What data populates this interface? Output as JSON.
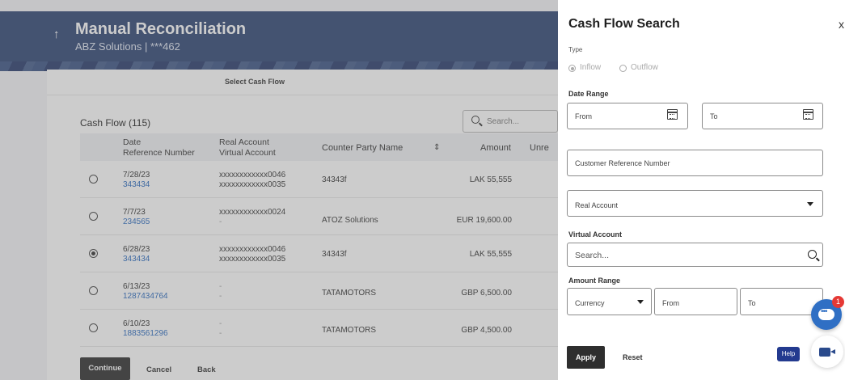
{
  "page": {
    "title": "Manual Reconciliation",
    "subtitle": "ABZ Solutions | ***462",
    "back_icon": "↑",
    "step_label": "Select Cash Flow"
  },
  "cash_flow": {
    "title": "Cash Flow (115)",
    "search_placeholder": "Search...",
    "columns": {
      "date": "Date",
      "ref": "Reference Number",
      "real": "Real Account",
      "virtual": "Virtual Account",
      "counter_party": "Counter Party Name",
      "sort_icon": "⇕",
      "amount": "Amount",
      "unreconciled": "Unre"
    },
    "rows": [
      {
        "date": "7/28/23",
        "ref": "343434",
        "real": "xxxxxxxxxxxx0046",
        "virtual": "xxxxxxxxxxxx0035",
        "party": "34343f",
        "amount": "LAK 55,555",
        "selected": false
      },
      {
        "date": "7/7/23",
        "ref": "234565",
        "real": "xxxxxxxxxxxx0024",
        "virtual": "-",
        "party": "ATOZ Solutions",
        "amount": "EUR 19,600.00",
        "selected": false
      },
      {
        "date": "6/28/23",
        "ref": "343434",
        "real": "xxxxxxxxxxxx0046",
        "virtual": "xxxxxxxxxxxx0035",
        "party": "34343f",
        "amount": "LAK 55,555",
        "selected": true
      },
      {
        "date": "6/13/23",
        "ref": "1287434764",
        "real": "-",
        "virtual": "-",
        "party": "TATAMOTORS",
        "amount": "GBP 6,500.00",
        "selected": false
      },
      {
        "date": "6/10/23",
        "ref": "1883561296",
        "real": "-",
        "virtual": "-",
        "party": "TATAMOTORS",
        "amount": "GBP 4,500.00",
        "selected": false
      }
    ],
    "buttons": {
      "continue": "Continue",
      "cancel": "Cancel",
      "back": "Back"
    }
  },
  "drawer": {
    "title": "Cash Flow Search",
    "close": "x",
    "type_label": "Type",
    "type_options": [
      "Inflow",
      "Outflow"
    ],
    "type_selected": "Inflow",
    "date_range_label": "Date Range",
    "from_placeholder": "From",
    "to_placeholder": "To",
    "customer_ref_placeholder": "Customer Reference Number",
    "real_account_placeholder": "Real Account",
    "virtual_account_label": "Virtual Account",
    "virtual_search_placeholder": "Search...",
    "amount_range_label": "Amount Range",
    "currency_placeholder": "Currency",
    "amount_from_placeholder": "From",
    "amount_to_placeholder": "To",
    "apply": "Apply",
    "reset": "Reset",
    "help": "Help"
  },
  "chat": {
    "badge_count": "1"
  }
}
